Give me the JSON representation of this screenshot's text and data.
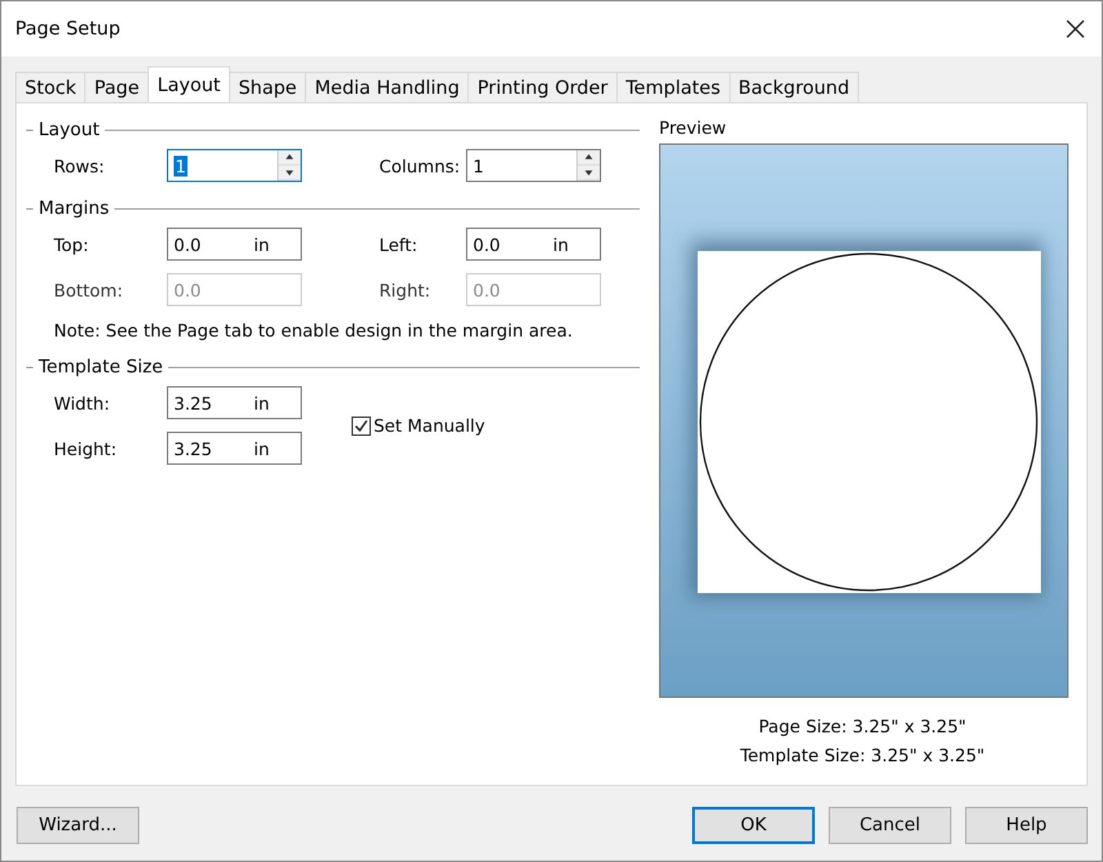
{
  "window": {
    "title": "Page Setup"
  },
  "tabs": [
    {
      "label": "Stock",
      "selected": false
    },
    {
      "label": "Page",
      "selected": false
    },
    {
      "label": "Layout",
      "selected": true
    },
    {
      "label": "Shape",
      "selected": false
    },
    {
      "label": "Media Handling",
      "selected": false
    },
    {
      "label": "Printing Order",
      "selected": false
    },
    {
      "label": "Templates",
      "selected": false
    },
    {
      "label": "Background",
      "selected": false
    }
  ],
  "sections": [
    {
      "title": "Layout",
      "fields": [
        {
          "label": "Rows:",
          "value": "1",
          "kind": "spinner",
          "focused": true,
          "disabled": false
        },
        {
          "label": "Columns:",
          "value": "1",
          "kind": "spinner",
          "focused": false,
          "disabled": false
        }
      ]
    },
    {
      "title": "Margins",
      "fields": [
        {
          "label": "Top:",
          "value": "0.0",
          "unit": "in",
          "kind": "text",
          "focused": false,
          "disabled": false
        },
        {
          "label": "Left:",
          "value": "0.0",
          "unit": "in",
          "kind": "text",
          "focused": false,
          "disabled": false
        },
        {
          "label": "Bottom:",
          "value": "0.0",
          "kind": "text",
          "focused": false,
          "disabled": true
        },
        {
          "label": "Right:",
          "value": "0.0",
          "kind": "text",
          "focused": false,
          "disabled": true
        }
      ],
      "note": "Note: See the Page tab to enable design in the margin area."
    },
    {
      "title": "Template Size",
      "fields": [
        {
          "label": "Width:",
          "value": "3.25",
          "unit": "in",
          "kind": "text",
          "focused": false,
          "disabled": false
        },
        {
          "label": "Height:",
          "value": "3.25",
          "unit": "in",
          "kind": "text",
          "focused": false,
          "disabled": false
        }
      ],
      "checkbox": {
        "label": "Set Manually",
        "checked": true
      }
    }
  ],
  "preview": {
    "title": "Preview",
    "captions": [
      "Page Size:  3.25\" x 3.25\"",
      "Template Size:  3.25\" x 3.25\""
    ]
  },
  "buttons": [
    {
      "label": "Wizard...",
      "default": false
    },
    {
      "label": "OK",
      "default": true
    },
    {
      "label": "Cancel",
      "default": false
    },
    {
      "label": "Help",
      "default": false
    }
  ]
}
